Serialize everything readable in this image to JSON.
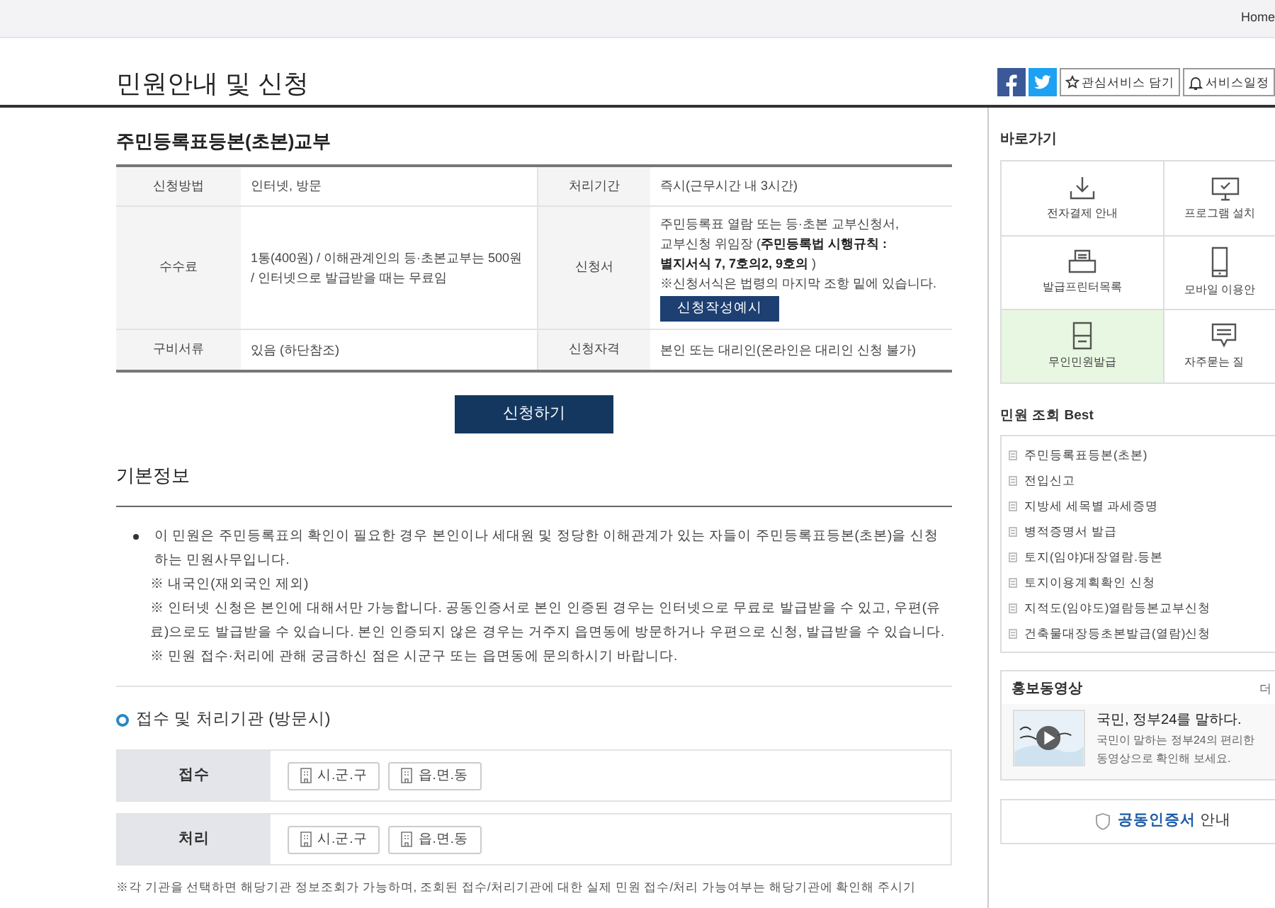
{
  "top_bar": {
    "link": "Home"
  },
  "page_title": "민원안내 및 신청",
  "share": [
    {
      "kind": "facebook"
    },
    {
      "kind": "twitter"
    }
  ],
  "actions": [
    {
      "kind": "star",
      "label": "관심서비스 담기"
    },
    {
      "kind": "bell",
      "label": "서비스일정"
    }
  ],
  "service": {
    "title": "주민등록표등본(초본)교부",
    "rows": [
      [
        {
          "label": "신청방법",
          "lines": [
            "인터넷, 방문"
          ]
        },
        {
          "label": "처리기간",
          "lines": [
            "즉시(근무시간 내 3시간)"
          ]
        }
      ],
      [
        {
          "label": "수수료",
          "lines": [
            "1통(400원) / 이해관계인의 등·초본교부는 500원 / 인터넷으로 발급받을 때는 무료임"
          ]
        },
        {
          "label": "신청서",
          "lines": [
            "주민등록표 열람 또는 등·초본 교부신청서,",
            "교부신청 위임장 (**주민등록법 시행규칙 :**",
            "**별지서식 7, 7호의2, 9호의** )",
            "※신청서식은 법령의 마지막 조항 밑에 있습니다."
          ],
          "button": "신청작성예시"
        }
      ],
      [
        {
          "label": "구비서류",
          "lines": [
            "있음 (하단참조)"
          ]
        },
        {
          "label": "신청자격",
          "lines": [
            "본인 또는 대리인(온라인은 대리인 신청 불가)"
          ]
        }
      ]
    ]
  },
  "apply_button": "신청하기",
  "basic_info": {
    "title": "기본정보",
    "bullet": "이 민원은 주민등록표의 확인이 필요한 경우 본인이나 세대원 및 정당한 이해관계가 있는 자들이 주민등록표등본(초본)을 신청하는 민원사무입니다.",
    "notes": [
      "※ 내국인(재외국인 제외)",
      "※ 인터넷 신청은 본인에 대해서만 가능합니다. 공동인증서로 본인 인증된 경우는 인터넷으로 무료로 발급받을 수 있고, 우편(유료)으로도 발급받을 수 있습니다. 본인 인증되지 않은 경우는 거주지 읍면동에 방문하거나 우편으로 신청, 발급받을 수 있습니다.",
      "※ 민원 접수·처리에 관해 궁금하신 점은 시군구 또는 읍면동에 문의하시기 바랍니다."
    ]
  },
  "agencies": {
    "title": "접수 및 처리기관 (방문시)",
    "rows": [
      {
        "label": "접수",
        "offices": [
          "시.군.구",
          "읍.면.동"
        ]
      },
      {
        "label": "처리",
        "offices": [
          "시.군.구",
          "읍.면.동"
        ]
      }
    ]
  },
  "footnote": "※각 기관을 선택하면 해당기관 정보조회가 가능하며, 조회된 접수/처리기관에 대한 실제 민원 접수/처리 가능여부는 해당기관에 확인해 주시기",
  "quick_links": {
    "title": "바로가기",
    "items": [
      {
        "kind": "download",
        "label": "전자결제 안내",
        "highlighted": false
      },
      {
        "kind": "monitor",
        "label": "프로그램 설치",
        "highlighted": false
      },
      {
        "kind": "printer",
        "label": "발급프린터목록",
        "highlighted": false
      },
      {
        "kind": "phone",
        "label": "모바일 이용안",
        "highlighted": false
      },
      {
        "kind": "kiosk",
        "label": "무인민원발급",
        "highlighted": true
      },
      {
        "kind": "chat",
        "label": "자주묻는 질",
        "highlighted": false
      }
    ]
  },
  "best": {
    "title": "민원 조회 Best",
    "items": [
      "주민등록표등본(초본)",
      "전입신고",
      "지방세 세목별 과세증명",
      "병적증명서 발급",
      "토지(임야)대장열람.등본",
      "토지이용계획확인 신청",
      "지적도(임야도)열람등본교부신청",
      "건축물대장등초본발급(열람)신청"
    ]
  },
  "video": {
    "title": "홍보동영상",
    "more": "더",
    "headline": "국민, 정부24를 말하다.",
    "lines": [
      "국민이 말하는 정부24의 편리한",
      "동영상으로 확인해 보세요."
    ]
  },
  "cert_button": "**공동인증서** 안내"
}
